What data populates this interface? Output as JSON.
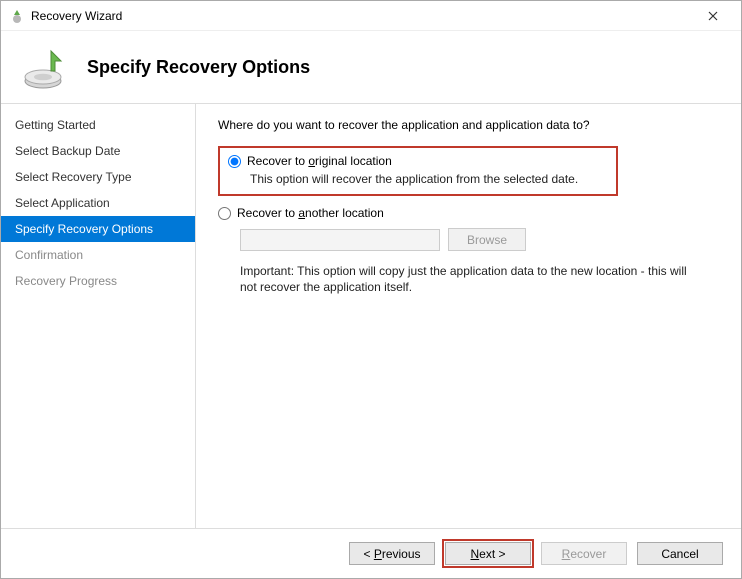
{
  "window": {
    "title": "Recovery Wizard"
  },
  "header": {
    "title": "Specify Recovery Options"
  },
  "sidebar": {
    "steps": [
      {
        "label": "Getting Started",
        "state": "done"
      },
      {
        "label": "Select Backup Date",
        "state": "done"
      },
      {
        "label": "Select Recovery Type",
        "state": "done"
      },
      {
        "label": "Select Application",
        "state": "done"
      },
      {
        "label": "Specify Recovery Options",
        "state": "active"
      },
      {
        "label": "Confirmation",
        "state": "pending"
      },
      {
        "label": "Recovery Progress",
        "state": "pending"
      }
    ]
  },
  "content": {
    "prompt": "Where do you want to recover the application and application data to?",
    "option_original": {
      "label_pre": "Recover to ",
      "label_u": "o",
      "label_post": "riginal location",
      "desc": "This option will recover the application from the selected date.",
      "selected": true
    },
    "option_another": {
      "label_pre": "Recover to ",
      "label_u": "a",
      "label_post": "nother location",
      "browse_label": "Browse",
      "path_value": "",
      "important": "Important: This option will copy just the application data to the new location - this will not recover the application itself.",
      "selected": false
    }
  },
  "footer": {
    "previous_pre": "< ",
    "previous_u": "P",
    "previous_post": "revious",
    "next_u": "N",
    "next_post": "ext >",
    "recover_u": "R",
    "recover_post": "ecover",
    "cancel": "Cancel"
  }
}
